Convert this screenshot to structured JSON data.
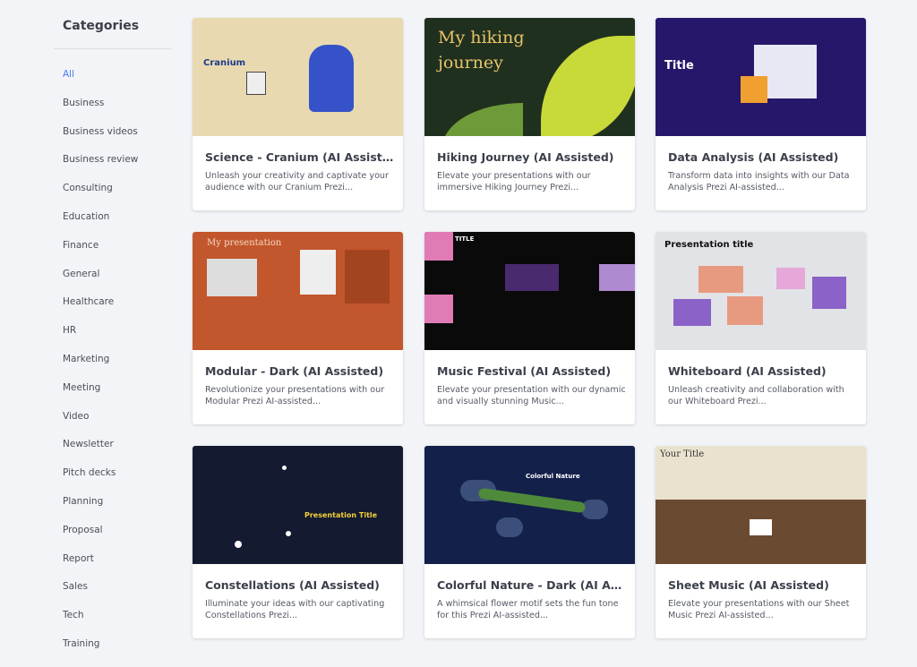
{
  "sidebar": {
    "heading": "Categories",
    "active": "All",
    "items": [
      "All",
      "Business",
      "Business videos",
      "Business review",
      "Consulting",
      "Education",
      "Finance",
      "General",
      "Healthcare",
      "HR",
      "Marketing",
      "Meeting",
      "Video",
      "Newsletter",
      "Pitch decks",
      "Planning",
      "Proposal",
      "Report",
      "Sales",
      "Tech",
      "Training"
    ]
  },
  "accent": "#4a7cf6",
  "cards": [
    {
      "title": "Science - Cranium (AI Assisted)",
      "desc": "Unleash your creativity and captivate your audience with our Cranium Prezi...",
      "thumb_text": "Cranium"
    },
    {
      "title": "Hiking Journey (AI Assisted)",
      "desc": "Elevate your presentations with our immersive Hiking Journey Prezi...",
      "thumb_text": "My hiking journey"
    },
    {
      "title": "Data Analysis (AI Assisted)",
      "desc": "Transform data into insights with our Data Analysis Prezi AI-assisted...",
      "thumb_text": "Title"
    },
    {
      "title": "Modular - Dark (AI Assisted)",
      "desc": "Revolutionize your presentations with our Modular Prezi AI-assisted...",
      "thumb_text": "My presentation"
    },
    {
      "title": "Music Festival (AI Assisted)",
      "desc": "Elevate your presentation with our dynamic and visually stunning Music...",
      "thumb_text": "TITLE"
    },
    {
      "title": "Whiteboard (AI Assisted)",
      "desc": "Unleash creativity and collaboration with our Whiteboard Prezi...",
      "thumb_text": "Presentation title"
    },
    {
      "title": "Constellations (AI Assisted)",
      "desc": "Illuminate your ideas with our captivating Constellations Prezi...",
      "thumb_text": "Presentation Title"
    },
    {
      "title": "Colorful Nature - Dark (AI Assisted)",
      "desc": "A whimsical flower motif sets the fun tone for this Prezi AI-assisted...",
      "thumb_text": "Colorful Nature"
    },
    {
      "title": "Sheet Music (AI Assisted)",
      "desc": "Elevate your presentations with our Sheet Music Prezi AI-assisted...",
      "thumb_text": "Your Title"
    }
  ]
}
